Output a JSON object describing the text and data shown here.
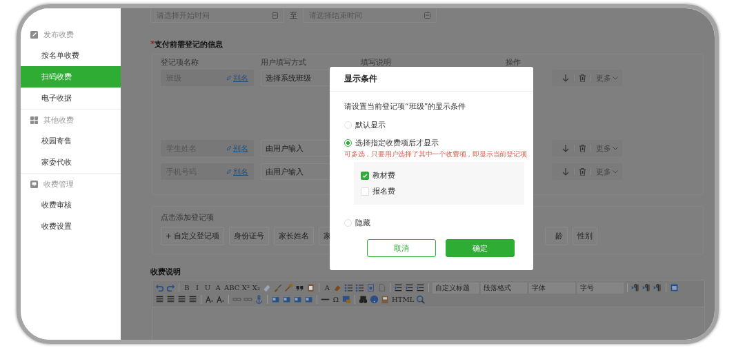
{
  "sidebar": {
    "groups": [
      {
        "title": "发布收费",
        "items": [
          {
            "label": "按名单收费",
            "selected": false
          },
          {
            "label": "扫码收费",
            "selected": true
          },
          {
            "label": "电子收据",
            "selected": false
          }
        ]
      },
      {
        "title": "其他收费",
        "items": [
          {
            "label": "校园寄售",
            "selected": false
          },
          {
            "label": "家委代收",
            "selected": false
          }
        ]
      },
      {
        "title": "收费管理",
        "items": [
          {
            "label": "收费审核",
            "selected": false
          },
          {
            "label": "收费设置",
            "selected": false
          }
        ]
      }
    ]
  },
  "date_range": {
    "start_placeholder": "请选择开始时间",
    "separator": "至",
    "end_placeholder": "请选择结束时间"
  },
  "registration": {
    "required_mark": "*",
    "title": "支付前需登记的信息",
    "columns": [
      "登记项名称",
      "用户填写方式",
      "填写说明",
      "操作"
    ],
    "rows": [
      {
        "name": "班级",
        "alias": "别名",
        "method": "选择系统班级",
        "more": "更多"
      },
      {
        "name": "学生姓名",
        "alias": "别名",
        "method": "由用户输入",
        "more": "更多"
      },
      {
        "name": "手机号码",
        "alias": "别名",
        "method": "由用户输入",
        "more": "更多"
      }
    ]
  },
  "add_items": {
    "title": "点击添加登记项",
    "buttons": [
      "+ 自定义登记项",
      "身份证号",
      "家长姓名",
      "家"
    ],
    "buttons_beyond_dialog": [
      "龄",
      "性别"
    ]
  },
  "fee_description": {
    "title": "收费说明",
    "toolbar": [
      [
        {
          "kind": "icon"
        },
        {
          "kind": "icon"
        },
        {
          "kind": "sep"
        },
        {
          "kind": "text",
          "label": "B"
        },
        {
          "kind": "text",
          "label": "I"
        },
        {
          "kind": "text",
          "label": "U"
        },
        {
          "kind": "text",
          "label": "A"
        },
        {
          "kind": "text",
          "label": "ABC"
        },
        {
          "kind": "text",
          "label": "X²"
        },
        {
          "kind": "text",
          "label": "X₂"
        },
        {
          "kind": "icon"
        },
        {
          "kind": "icon"
        },
        {
          "kind": "icon"
        },
        {
          "kind": "icon"
        },
        {
          "kind": "icon"
        },
        {
          "kind": "sep"
        },
        {
          "kind": "text",
          "label": "A"
        },
        {
          "kind": "icon"
        },
        {
          "kind": "icon"
        },
        {
          "kind": "icon"
        },
        {
          "kind": "icon"
        },
        {
          "kind": "icon"
        },
        {
          "kind": "sep"
        },
        {
          "kind": "icon"
        },
        {
          "kind": "icon"
        },
        {
          "kind": "icon"
        },
        {
          "kind": "sep"
        },
        {
          "kind": "select",
          "label": "自定义标题"
        },
        {
          "kind": "select",
          "label": "段落格式"
        },
        {
          "kind": "select",
          "label": "字体"
        },
        {
          "kind": "select",
          "label": "字号"
        },
        {
          "kind": "sep"
        },
        {
          "kind": "icon"
        },
        {
          "kind": "icon"
        },
        {
          "kind": "icon"
        },
        {
          "kind": "sep"
        },
        {
          "kind": "icon"
        }
      ],
      [
        {
          "kind": "icon"
        },
        {
          "kind": "icon"
        },
        {
          "kind": "icon"
        },
        {
          "kind": "icon"
        },
        {
          "kind": "sep"
        },
        {
          "kind": "icon"
        },
        {
          "kind": "icon"
        },
        {
          "kind": "sep"
        },
        {
          "kind": "icon"
        },
        {
          "kind": "icon"
        },
        {
          "kind": "icon"
        },
        {
          "kind": "sep"
        },
        {
          "kind": "icon"
        },
        {
          "kind": "icon"
        },
        {
          "kind": "icon"
        },
        {
          "kind": "icon"
        },
        {
          "kind": "sep"
        },
        {
          "kind": "icon"
        },
        {
          "kind": "text",
          "label": "Ω"
        },
        {
          "kind": "icon"
        },
        {
          "kind": "sep"
        },
        {
          "kind": "icon"
        },
        {
          "kind": "icon"
        },
        {
          "kind": "icon"
        },
        {
          "kind": "text",
          "label": "HTML"
        },
        {
          "kind": "icon"
        }
      ]
    ]
  },
  "dialog": {
    "title": "显示条件",
    "prompt": "请设置当前登记项“班级”的显示条件",
    "options": [
      {
        "label": "默认显示",
        "selected": false
      },
      {
        "label": "选择指定收费项后才显示",
        "selected": true,
        "hint": "可多选，只要用户选择了其中一个收费项，即显示当前登记项",
        "fees": [
          {
            "label": "教材费",
            "checked": true
          },
          {
            "label": "报名费",
            "checked": false
          }
        ]
      },
      {
        "label": "隐藏",
        "selected": false
      }
    ],
    "cancel": "取消",
    "confirm": "确定"
  }
}
